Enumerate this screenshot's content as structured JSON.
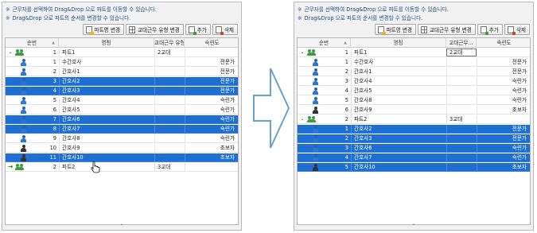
{
  "notes": {
    "mark": "※",
    "line1": "근무자를 선택하여 Drag&Drop 으로 파트를 이동할 수 있습니다.",
    "line2": "Drag&Drop 으로 파트의 순서를 변경할 수 있습니다."
  },
  "toolbar": {
    "rename_label": "파트명 변경",
    "shift_type_label": "교대근무 유형 변경",
    "add_label": "추가",
    "delete_label": "삭제"
  },
  "headers": {
    "seq": "순번",
    "name": "명칭",
    "shift_left": "교대근무 유형",
    "shift_right": "교대근무...",
    "skill": "숙련도",
    "sort_glyph": "▲"
  },
  "left_grid": {
    "rows": [
      {
        "type": "group",
        "num": "1",
        "name": "파트1",
        "shift": "2교대",
        "skill": "",
        "selected": false,
        "expander": "⌄"
      },
      {
        "type": "person",
        "icon": "blue",
        "num": "1",
        "name": "수간호사",
        "shift": "",
        "skill": "전문가",
        "selected": false
      },
      {
        "type": "person",
        "icon": "blue",
        "num": "2",
        "name": "간호사1",
        "shift": "",
        "skill": "전문가",
        "selected": false
      },
      {
        "type": "person",
        "icon": "blue",
        "num": "3",
        "name": "간호사2",
        "shift": "",
        "skill": "전문가",
        "selected": true
      },
      {
        "type": "person",
        "icon": "blue",
        "num": "4",
        "name": "간호사3",
        "shift": "",
        "skill": "전문가",
        "selected": true
      },
      {
        "type": "person",
        "icon": "blue",
        "num": "5",
        "name": "간호사4",
        "shift": "",
        "skill": "숙련가",
        "selected": false
      },
      {
        "type": "person",
        "icon": "blue",
        "num": "6",
        "name": "간호사5",
        "shift": "",
        "skill": "숙련가",
        "selected": false
      },
      {
        "type": "person",
        "icon": "blue",
        "num": "7",
        "name": "간호사6",
        "shift": "",
        "skill": "숙련가",
        "selected": true
      },
      {
        "type": "person",
        "icon": "blue",
        "num": "8",
        "name": "간호사7",
        "shift": "",
        "skill": "숙련가",
        "selected": true
      },
      {
        "type": "person",
        "icon": "blue",
        "num": "9",
        "name": "간호사8",
        "shift": "",
        "skill": "숙련가",
        "selected": false
      },
      {
        "type": "person",
        "icon": "dark",
        "num": "10",
        "name": "간호사9",
        "shift": "",
        "skill": "초보자",
        "selected": false
      },
      {
        "type": "person",
        "icon": "dark",
        "num": "11",
        "name": "간호사10",
        "shift": "",
        "skill": "초보자",
        "selected": true
      },
      {
        "type": "group",
        "num": "2",
        "name": "파트2",
        "shift": "3교대",
        "skill": "",
        "selected": false,
        "expander": "➜"
      }
    ]
  },
  "right_grid": {
    "rows": [
      {
        "type": "group",
        "num": "1",
        "name": "파트1",
        "shift": "2교대",
        "skill": "",
        "selected": false,
        "expander": "⌄",
        "editing": true
      },
      {
        "type": "person",
        "icon": "blue",
        "num": "1",
        "name": "수간호사",
        "shift": "",
        "skill": "전문가",
        "selected": false
      },
      {
        "type": "person",
        "icon": "blue",
        "num": "2",
        "name": "간호사1",
        "shift": "",
        "skill": "전문가",
        "selected": false
      },
      {
        "type": "person",
        "icon": "blue",
        "num": "3",
        "name": "간호사4",
        "shift": "",
        "skill": "숙련가",
        "selected": false
      },
      {
        "type": "person",
        "icon": "blue",
        "num": "4",
        "name": "간호사5",
        "shift": "",
        "skill": "숙련가",
        "selected": false
      },
      {
        "type": "person",
        "icon": "blue",
        "num": "5",
        "name": "간호사8",
        "shift": "",
        "skill": "숙련가",
        "selected": false
      },
      {
        "type": "person",
        "icon": "dark",
        "num": "6",
        "name": "간호사9",
        "shift": "",
        "skill": "초보자",
        "selected": false
      },
      {
        "type": "group",
        "num": "2",
        "name": "파트2",
        "shift": "3교대",
        "skill": "",
        "selected": false,
        "expander": "⌄"
      },
      {
        "type": "person",
        "icon": "blue",
        "num": "1",
        "name": "간호사2",
        "shift": "",
        "skill": "전문가",
        "selected": true
      },
      {
        "type": "person",
        "icon": "blue",
        "num": "2",
        "name": "간호사3",
        "shift": "",
        "skill": "전문가",
        "selected": true
      },
      {
        "type": "person",
        "icon": "blue",
        "num": "3",
        "name": "간호사6",
        "shift": "",
        "skill": "숙련가",
        "selected": true
      },
      {
        "type": "person",
        "icon": "blue",
        "num": "4",
        "name": "간호사7",
        "shift": "",
        "skill": "숙련가",
        "selected": true
      },
      {
        "type": "person",
        "icon": "dark",
        "num": "5",
        "name": "간호사10",
        "shift": "",
        "skill": "초보자",
        "selected": true
      }
    ]
  },
  "bottom_glyph": "⌃",
  "colors": {
    "selection": "#1e6fd1",
    "note_text": "#1f4f8f",
    "group_icon": "#3e9a45",
    "arrow_stroke": "#6a9fd6"
  }
}
